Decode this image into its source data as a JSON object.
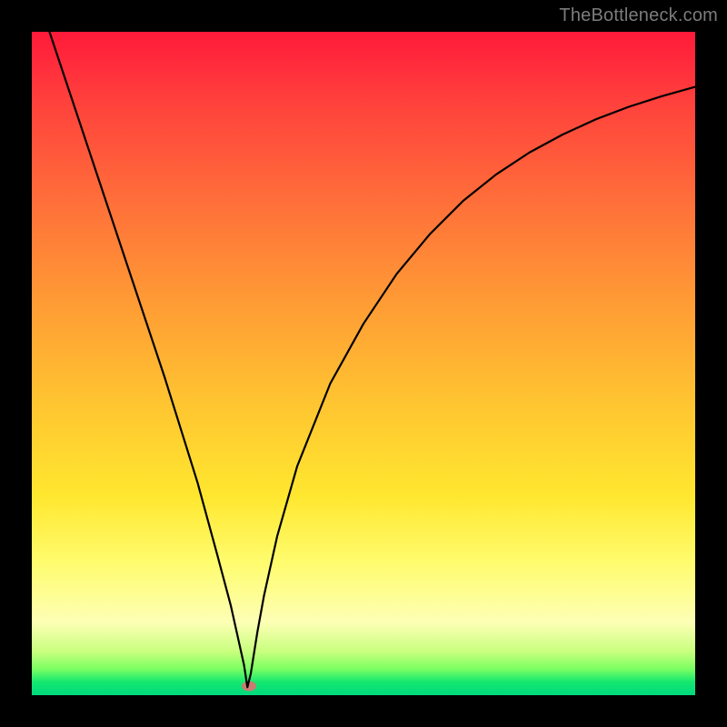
{
  "watermark": "TheBottleneck.com",
  "colors": {
    "frame": "#000000",
    "curve": "#000000",
    "marker": "#cb7b72",
    "gradient_top": "#ff1a3a",
    "gradient_mid": "#ffe72f",
    "gradient_bottom": "#00d97e"
  },
  "marker": {
    "x_pct": 32.8,
    "y_pct": 98.6
  },
  "chart_data": {
    "type": "line",
    "title": "",
    "xlabel": "",
    "ylabel": "",
    "xlim": [
      0,
      100
    ],
    "ylim": [
      0,
      100
    ],
    "series": [
      {
        "name": "bottleneck-curve",
        "x": [
          0,
          5,
          10,
          15,
          20,
          25,
          28,
          30,
          31,
          32,
          32.5,
          33,
          34,
          35,
          37,
          40,
          45,
          50,
          55,
          60,
          65,
          70,
          75,
          80,
          85,
          90,
          95,
          100
        ],
        "values": [
          108,
          93,
          78,
          63,
          48,
          32,
          21,
          13.5,
          9,
          4.5,
          1.2,
          3.2,
          9.5,
          15,
          24,
          34.5,
          47,
          56,
          63.5,
          69.5,
          74.5,
          78.5,
          81.8,
          84.5,
          86.8,
          88.7,
          90.3,
          91.7
        ]
      }
    ],
    "annotations": [
      {
        "name": "optimal-point",
        "x": 32.5,
        "y": 1.2
      }
    ]
  }
}
